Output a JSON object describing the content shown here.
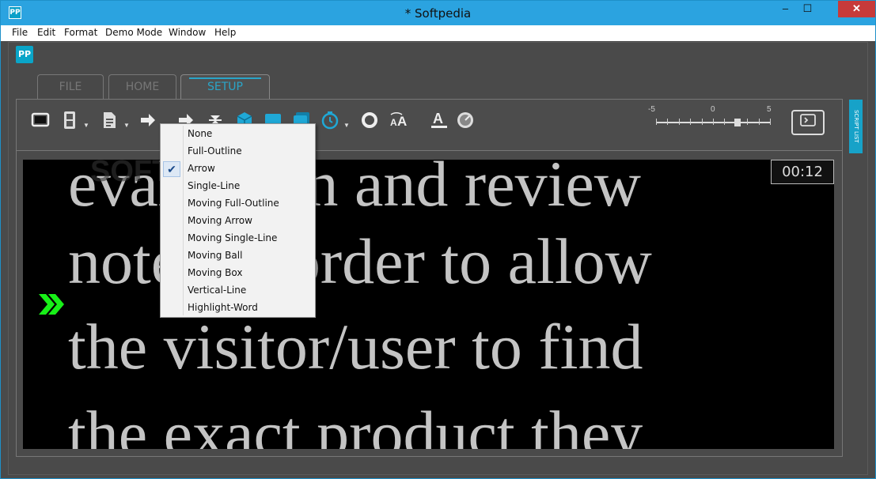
{
  "window": {
    "title": "* Softpedia",
    "app_icon": "PP",
    "minimize": "–",
    "maximize": "☐",
    "close": "✕"
  },
  "menu": [
    "File",
    "Edit",
    "Format",
    "Demo Mode",
    "Window",
    "Help"
  ],
  "logo": "PP",
  "tabs": [
    {
      "label": "FILE",
      "active": false
    },
    {
      "label": "HOME",
      "active": false
    },
    {
      "label": "SETUP",
      "active": true
    }
  ],
  "ribbon": {
    "icons": [
      "display-icon",
      "film-icon",
      "document-icon",
      "arrow-right-icon",
      "arrow-right-icon",
      "filter-icon",
      "cube-icon",
      "box-icon",
      "stack-icon",
      "timer-icon",
      "ring-icon",
      "font-size-icon",
      "font-color-icon",
      "speed-gauge-icon"
    ],
    "slider": {
      "min_label": "-5",
      "mid_label": "0",
      "max_label": "5",
      "value": 3
    }
  },
  "script_list_label": "SCRIPT LIST",
  "prompter": {
    "watermark": "SOFTPEDIA",
    "lines": [
      "evaluation and review",
      "notes in order to allow",
      "the visitor/user to find",
      "the exact product they"
    ],
    "timer": "00:12",
    "cue_color": "#18f018"
  },
  "dropdown": {
    "items": [
      "None",
      "Full-Outline",
      "Arrow",
      "Single-Line",
      "Moving Full-Outline",
      "Moving Arrow",
      "Moving Single-Line",
      "Moving Ball",
      "Moving Box",
      "Vertical-Line",
      "Highlight-Word"
    ],
    "selected": "Arrow",
    "check": "✔"
  },
  "colors": {
    "accent": "#1fa8d6",
    "title_bar": "#2ba3e0",
    "background": "#4a4a4a"
  }
}
